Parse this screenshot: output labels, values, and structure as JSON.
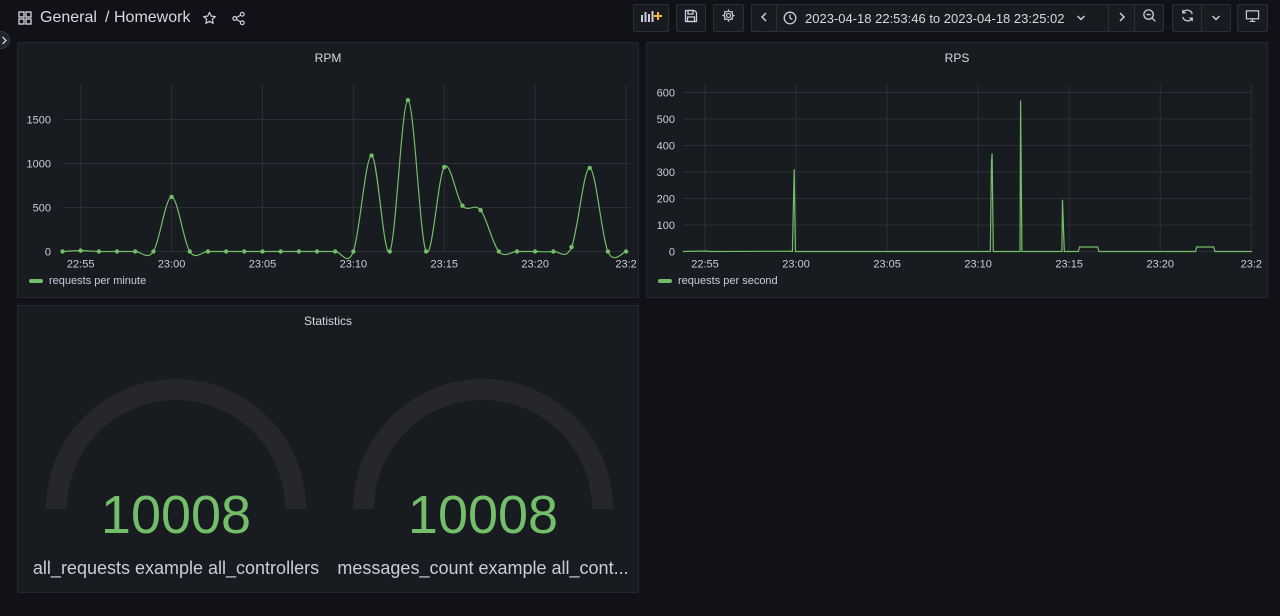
{
  "header": {
    "folder": "General",
    "separator": "/",
    "dashboard": "Homework",
    "time_range": "2023-04-18 22:53:46 to 2023-04-18 23:25:02",
    "icons": [
      "dashboard-grid-icon",
      "star-icon",
      "share-icon",
      "add-panel-icon",
      "save-icon",
      "settings-icon",
      "chevron-left-icon",
      "clock-icon",
      "chevron-down-icon",
      "chevron-right-icon",
      "zoom-out-icon",
      "refresh-icon",
      "kiosk-icon"
    ]
  },
  "colors": {
    "series": "#73bf69",
    "background": "#111217",
    "panel": "#181b1f",
    "gauge_track": "#25272d"
  },
  "panels": {
    "rpm": {
      "title": "RPM",
      "legend": "requests per minute"
    },
    "rps": {
      "title": "RPS",
      "legend": "requests per second"
    },
    "stats": {
      "title": "Statistics",
      "gauges": [
        {
          "value": "10008",
          "label": "all_requests example all_controllers"
        },
        {
          "value": "10008",
          "label": "messages_count example all_cont..."
        }
      ]
    }
  },
  "chart_data": [
    {
      "type": "line",
      "title": "RPM",
      "x_tick_labels": [
        "22:55",
        "23:00",
        "23:05",
        "23:10",
        "23:15",
        "23:20",
        "23:2"
      ],
      "y_tick_labels": [
        "0",
        "500",
        "1000",
        "1500"
      ],
      "ylim": [
        0,
        1900
      ],
      "xlim": [
        "22:54",
        "23:25"
      ],
      "grid": true,
      "legend_position": "bottom-left",
      "series": [
        {
          "name": "requests per minute",
          "color": "#73bf69",
          "x": [
            "22:54",
            "22:55",
            "22:56",
            "22:57",
            "22:58",
            "22:59",
            "23:00",
            "23:01",
            "23:02",
            "23:03",
            "23:04",
            "23:05",
            "23:06",
            "23:07",
            "23:08",
            "23:09",
            "23:10",
            "23:11",
            "23:12",
            "23:13",
            "23:14",
            "23:15",
            "23:16",
            "23:17",
            "23:18",
            "23:19",
            "23:20",
            "23:21",
            "23:22",
            "23:23",
            "23:24",
            "23:25"
          ],
          "values": [
            0,
            10,
            0,
            0,
            0,
            0,
            620,
            0,
            0,
            0,
            0,
            0,
            0,
            0,
            0,
            0,
            0,
            1090,
            0,
            1720,
            0,
            960,
            520,
            470,
            0,
            0,
            0,
            0,
            50,
            950,
            0,
            0
          ]
        }
      ]
    },
    {
      "type": "line",
      "title": "RPS",
      "x_tick_labels": [
        "22:55",
        "23:00",
        "23:05",
        "23:10",
        "23:15",
        "23:20",
        "23:2"
      ],
      "y_tick_labels": [
        "0",
        "100",
        "200",
        "300",
        "400",
        "500",
        "600"
      ],
      "ylim": [
        0,
        640
      ],
      "xlim": [
        "22:53",
        "23:25"
      ],
      "grid": true,
      "legend_position": "bottom-left",
      "series": [
        {
          "name": "requests per second",
          "color": "#73bf69",
          "points": [
            {
              "x": "22:53:46",
              "y": 0
            },
            {
              "x": "22:55:00",
              "y": 2
            },
            {
              "x": "22:55:20",
              "y": 0
            },
            {
              "x": "22:59:40",
              "y": 1
            },
            {
              "x": "22:59:48",
              "y": 0
            },
            {
              "x": "22:59:54",
              "y": 310
            },
            {
              "x": "22:59:58",
              "y": 0
            },
            {
              "x": "23:10:40",
              "y": 0
            },
            {
              "x": "23:10:44",
              "y": 340
            },
            {
              "x": "23:10:46",
              "y": 370
            },
            {
              "x": "23:10:50",
              "y": 0
            },
            {
              "x": "23:12:18",
              "y": 0
            },
            {
              "x": "23:12:20",
              "y": 570
            },
            {
              "x": "23:12:24",
              "y": 0
            },
            {
              "x": "23:14:36",
              "y": 0
            },
            {
              "x": "23:14:38",
              "y": 195
            },
            {
              "x": "23:14:44",
              "y": 0
            },
            {
              "x": "23:15:30",
              "y": 0
            },
            {
              "x": "23:15:34",
              "y": 17
            },
            {
              "x": "23:16:34",
              "y": 17
            },
            {
              "x": "23:16:38",
              "y": 0
            },
            {
              "x": "23:21:56",
              "y": 0
            },
            {
              "x": "23:22:00",
              "y": 17
            },
            {
              "x": "23:22:56",
              "y": 17
            },
            {
              "x": "23:23:00",
              "y": 0
            },
            {
              "x": "23:25:02",
              "y": 0
            }
          ]
        }
      ]
    }
  ]
}
